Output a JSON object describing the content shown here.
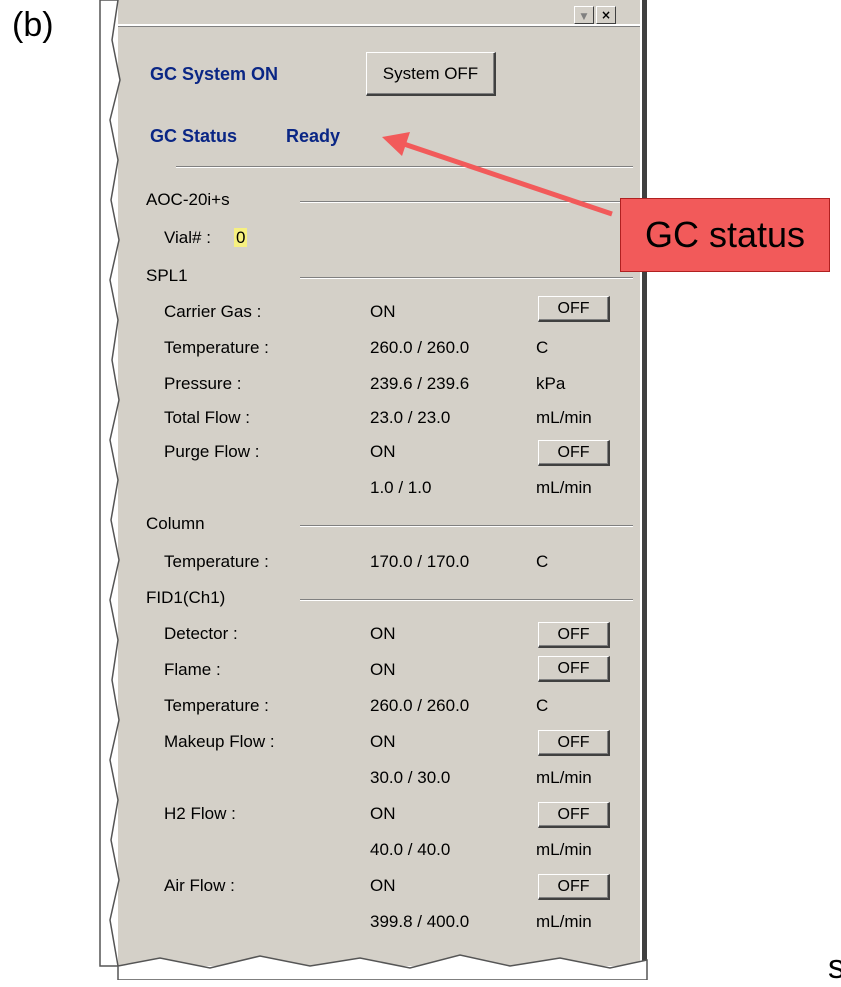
{
  "figure_label": "(b)",
  "titlebar": {
    "min_glyph": "▼",
    "close_glyph": "×"
  },
  "system": {
    "title": "GC System  ON",
    "off_button": "System OFF",
    "status_label": "GC Status",
    "status_value": "Ready"
  },
  "aoc": {
    "header": "AOC-20i+s",
    "vial_label": "Vial# :",
    "vial_value": "0"
  },
  "spl1": {
    "header": "SPL1",
    "rows": [
      {
        "label": "Carrier Gas :",
        "value": "ON",
        "unit": "",
        "button": "OFF"
      },
      {
        "label": "Temperature :",
        "value": "260.0 / 260.0",
        "unit": "C"
      },
      {
        "label": "Pressure :",
        "value": "239.6 / 239.6",
        "unit": "kPa"
      },
      {
        "label": "Total Flow :",
        "value": "23.0 / 23.0",
        "unit": "mL/min"
      },
      {
        "label": "Purge Flow :",
        "value": "ON",
        "unit": "",
        "button": "OFF"
      },
      {
        "label": "",
        "value": "1.0 / 1.0",
        "unit": "mL/min"
      }
    ]
  },
  "column": {
    "header": "Column",
    "rows": [
      {
        "label": "Temperature :",
        "value": "170.0 / 170.0",
        "unit": "C"
      }
    ]
  },
  "fid": {
    "header": "FID1(Ch1)",
    "rows": [
      {
        "label": "Detector :",
        "value": "ON",
        "button": "OFF"
      },
      {
        "label": "Flame :",
        "value": "ON",
        "button": "OFF"
      },
      {
        "label": "Temperature :",
        "value": "260.0 / 260.0",
        "unit": "C"
      },
      {
        "label": "Makeup Flow :",
        "value": "ON",
        "button": "OFF"
      },
      {
        "label": "",
        "value": "30.0 / 30.0",
        "unit": "mL/min"
      },
      {
        "label": "H2 Flow :",
        "value": "ON",
        "button": "OFF"
      },
      {
        "label": "",
        "value": "40.0 / 40.0",
        "unit": "mL/min"
      },
      {
        "label": "Air Flow :",
        "value": "ON",
        "button": "OFF"
      },
      {
        "label": "",
        "value": "399.8 / 400.0",
        "unit": "mL/min"
      }
    ]
  },
  "callout": {
    "text": "GC status",
    "color": "#f25a5a"
  },
  "corner_text": "s"
}
